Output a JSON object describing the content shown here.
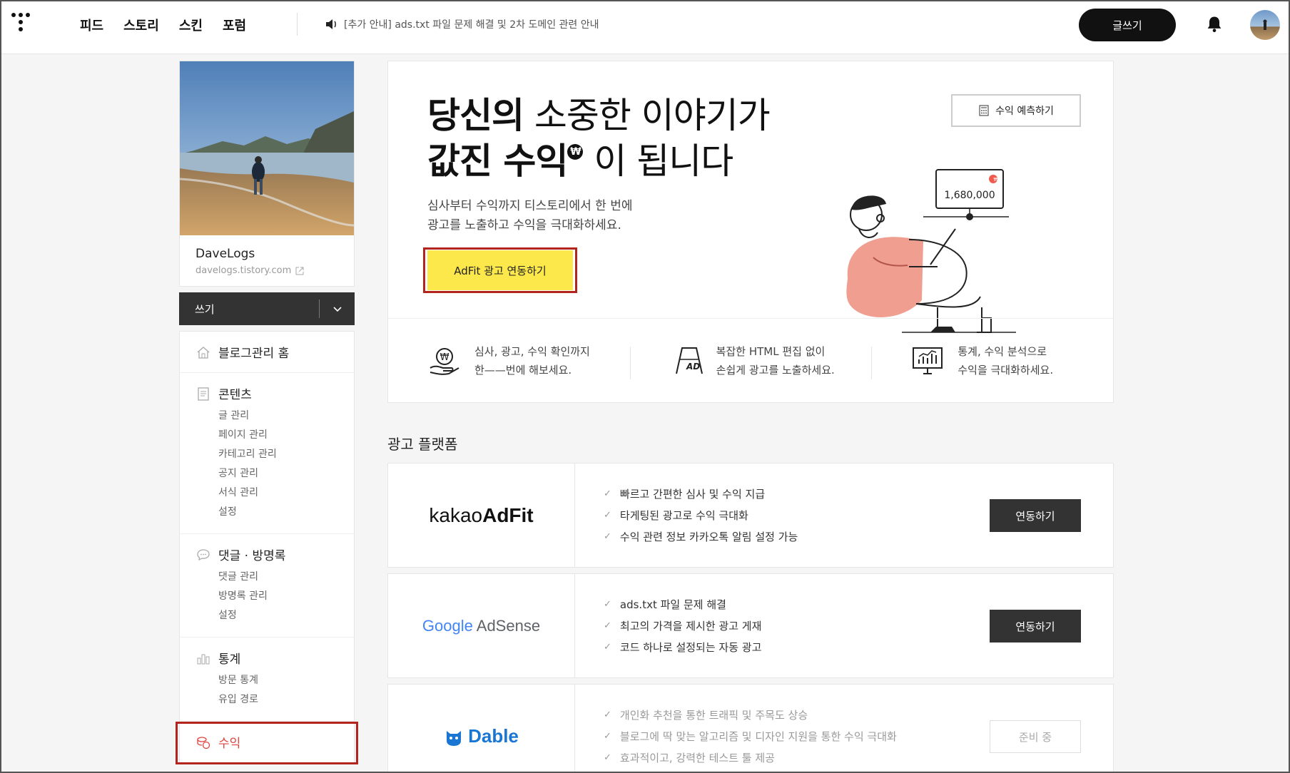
{
  "topbar": {
    "nav": [
      "피드",
      "스토리",
      "스킨",
      "포럼"
    ],
    "notice": "[추가 안내] ads.txt 파일 문제 해결 및 2차 도메인 관련 안내",
    "write_label": "글쓰기"
  },
  "sidebar": {
    "blog_name": "DaveLogs",
    "blog_url": "davelogs.tistory.com",
    "write_label": "쓰기",
    "home_label": "블로그관리 홈",
    "content": {
      "title": "콘텐츠",
      "items": [
        "글 관리",
        "페이지 관리",
        "카테고리 관리",
        "공지 관리",
        "서식 관리",
        "설정"
      ]
    },
    "comments": {
      "title": "댓글 · 방명록",
      "items": [
        "댓글 관리",
        "방명록 관리",
        "설정"
      ]
    },
    "stats": {
      "title": "통계",
      "items": [
        "방문 통계",
        "유입 경로"
      ]
    },
    "revenue_label": "수익"
  },
  "hero": {
    "title_line1_bold": "당신의",
    "title_line1_light": " 소중한 이야기가",
    "title_line2_bold": "값진 수익",
    "won_symbol": "₩",
    "title_line2_light": " 이 됩니다",
    "desc_line1": "심사부터 수익까지 티스토리에서 한 번에",
    "desc_line2": "광고를 노출하고 수익을 극대화하세요.",
    "adfit_button": "AdFit 광고 연동하기",
    "predict_button": "수익 예측하기",
    "illust_amount": "1,680,000"
  },
  "features": [
    {
      "line1": "심사, 광고, 수익 확인까지",
      "line2": "한——번에 해보세요."
    },
    {
      "line1": "복잡한 HTML 편집 없이",
      "line2": "손쉽게 광고를 노출하세요."
    },
    {
      "line1": "통계, 수익 분석으로",
      "line2": "수익을 극대화하세요."
    }
  ],
  "section_title": "광고 플랫폼",
  "platforms": [
    {
      "logo_light": "kakao",
      "logo_bold": "AdFit",
      "items": [
        "빠르고 간편한 심사 및 수익 지급",
        "타게팅된 광고로 수익 극대화",
        "수익 관련 정보 카카오톡 알림 설정 가능"
      ],
      "button": "연동하기"
    },
    {
      "logo_google": "Google",
      "logo_rest": " AdSense",
      "items": [
        "ads.txt 파일 문제 해결",
        "최고의 가격을 제시한 광고 게재",
        "코드 하나로 설정되는 자동 광고"
      ],
      "button": "연동하기"
    },
    {
      "logo": "Dable",
      "items": [
        "개인화 추천을 통한 트래픽 및 주목도 상승",
        "블로그에 딱 맞는 알고리즘 및 디자인 지원을 통한 수익 극대화",
        "효과적이고, 강력한 테스트 툴 제공"
      ],
      "button": "준비 중"
    }
  ],
  "colors": {
    "accent_red": "#e0443e",
    "adfit_yellow": "#fce84a",
    "dark": "#333333"
  }
}
